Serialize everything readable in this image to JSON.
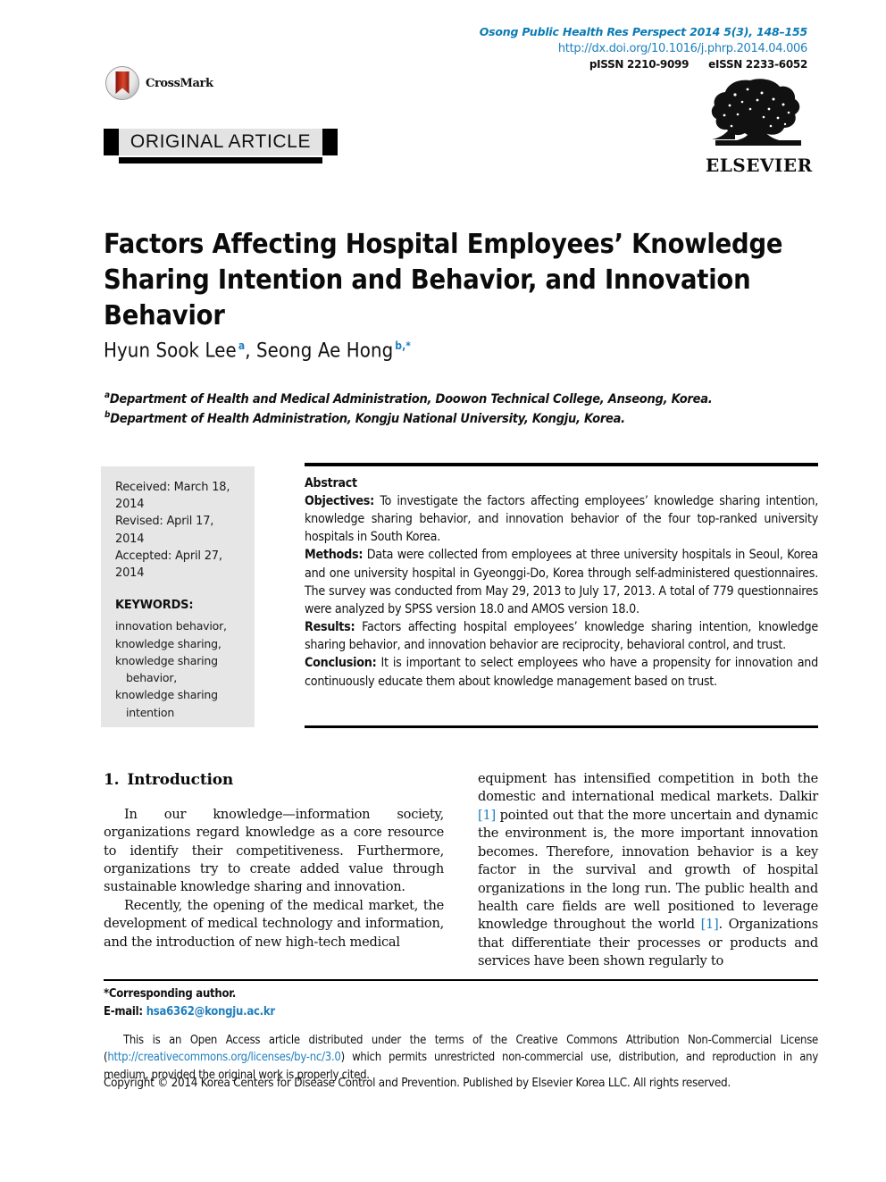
{
  "header": {
    "journal_ref": "Osong Public Health Res Perspect 2014 5(3), 148–155",
    "doi_url": "http://dx.doi.org/10.1016/j.phrp.2014.04.006",
    "pissn": "pISSN 2210-9099",
    "eissn": "eISSN 2233-6052",
    "crossmark_label": "CrossMark",
    "publisher_logo_label": "ELSEVIER"
  },
  "banner": {
    "label": "ORIGINAL ARTICLE"
  },
  "article": {
    "title": "Factors Affecting Hospital Employees’ Knowledge Sharing Intention and Behavior, and Innovation Behavior",
    "authors_plain": "Hyun Sook Lee a, Seong Ae Hong b,*",
    "author_1": "Hyun Sook Lee",
    "author_1_sup": "a",
    "author_2": "Seong Ae Hong",
    "author_2_sup": "b,*",
    "affiliation_a_sup": "a",
    "affiliation_a": "Department of Health and Medical Administration, Doowon Technical College, Anseong, Korea.",
    "affiliation_b_sup": "b",
    "affiliation_b": "Department of Health Administration, Kongju National University, Kongju, Korea."
  },
  "sidebar": {
    "dates": "Received: March 18, 2014\nRevised: April 17, 2014\nAccepted: April 27, 2014",
    "received": "Received: March 18, 2014",
    "revised": "Revised: April 17, 2014",
    "accepted": "Accepted: April 27, 2014",
    "keywords_title": "KEYWORDS:",
    "keywords": [
      "innovation behavior,",
      "knowledge sharing,",
      "knowledge sharing",
      "behavior,",
      "knowledge sharing",
      "intention"
    ]
  },
  "abstract": {
    "label": "Abstract",
    "sections": [
      {
        "heading": "Objectives:",
        "text": " To investigate the factors affecting employees’ knowledge sharing intention, knowledge sharing behavior, and innovation behavior of the four top-ranked university hospitals in South Korea."
      },
      {
        "heading": "Methods:",
        "text": " Data were collected from employees at three university hospitals in Seoul, Korea and one university hospital in Gyeonggi-Do, Korea through self-administered questionnaires. The survey was conducted from May 29, 2013 to July 17, 2013. A total of 779 questionnaires were analyzed by SPSS version 18.0 and AMOS version 18.0."
      },
      {
        "heading": "Results:",
        "text": " Factors affecting hospital employees’ knowledge sharing intention, knowledge sharing behavior, and innovation behavior are reciprocity, behavioral control, and trust."
      },
      {
        "heading": "Conclusion:",
        "text": " It is important to select employees who have a propensity for innovation and continuously educate them about knowledge management based on trust."
      }
    ]
  },
  "body": {
    "section_number": "1.",
    "section_title": "Introduction",
    "left_paragraphs": [
      "In our knowledge—information society, organizations regard knowledge as a core resource to identify their competitiveness. Furthermore, organizations try to create added value through sustainable knowledge sharing and innovation.",
      "Recently, the opening of the medical market, the development of medical technology and information, and the introduction of new high-tech medical"
    ],
    "right_paragraph_part1": "equipment has intensified competition in both the domestic and international medical markets. Dalkir ",
    "right_citation_1": "[1]",
    "right_paragraph_part2": " pointed out that the more uncertain and dynamic the environment is, the more important innovation becomes. Therefore, innovation behavior is a key factor in the survival and growth of hospital organizations in the long run. The public health and health care fields are well positioned to leverage knowledge throughout the world ",
    "right_citation_2": "[1]",
    "right_paragraph_part3": ". Organizations that differentiate their processes or products and services have been shown regularly to"
  },
  "footer": {
    "corresponding": "*Corresponding author.",
    "email_label": "E-mail:",
    "email": "hsa6362@kongju.ac.kr",
    "license_part1": "This is an Open Access article distributed under the terms of the Creative Commons Attribution Non-Commercial License (",
    "license_url": "http://creativecommons.org/licenses/by-nc/3.0",
    "license_part2": ") which permits unrestricted non-commercial use, distribution, and reproduction in any medium, provided the original work is properly cited.",
    "copyright": "Copyright © 2014 Korea Centers for Disease Control and Prevention. Published by Elsevier Korea LLC. All rights reserved."
  },
  "colors": {
    "link_blue": "#1f7fbe",
    "journal_teal": "#0a7bb5",
    "banner_gray": "#e3e3e3",
    "sidebar_gray": "#e6e6e6",
    "crossmark_red": "#c0301c"
  }
}
